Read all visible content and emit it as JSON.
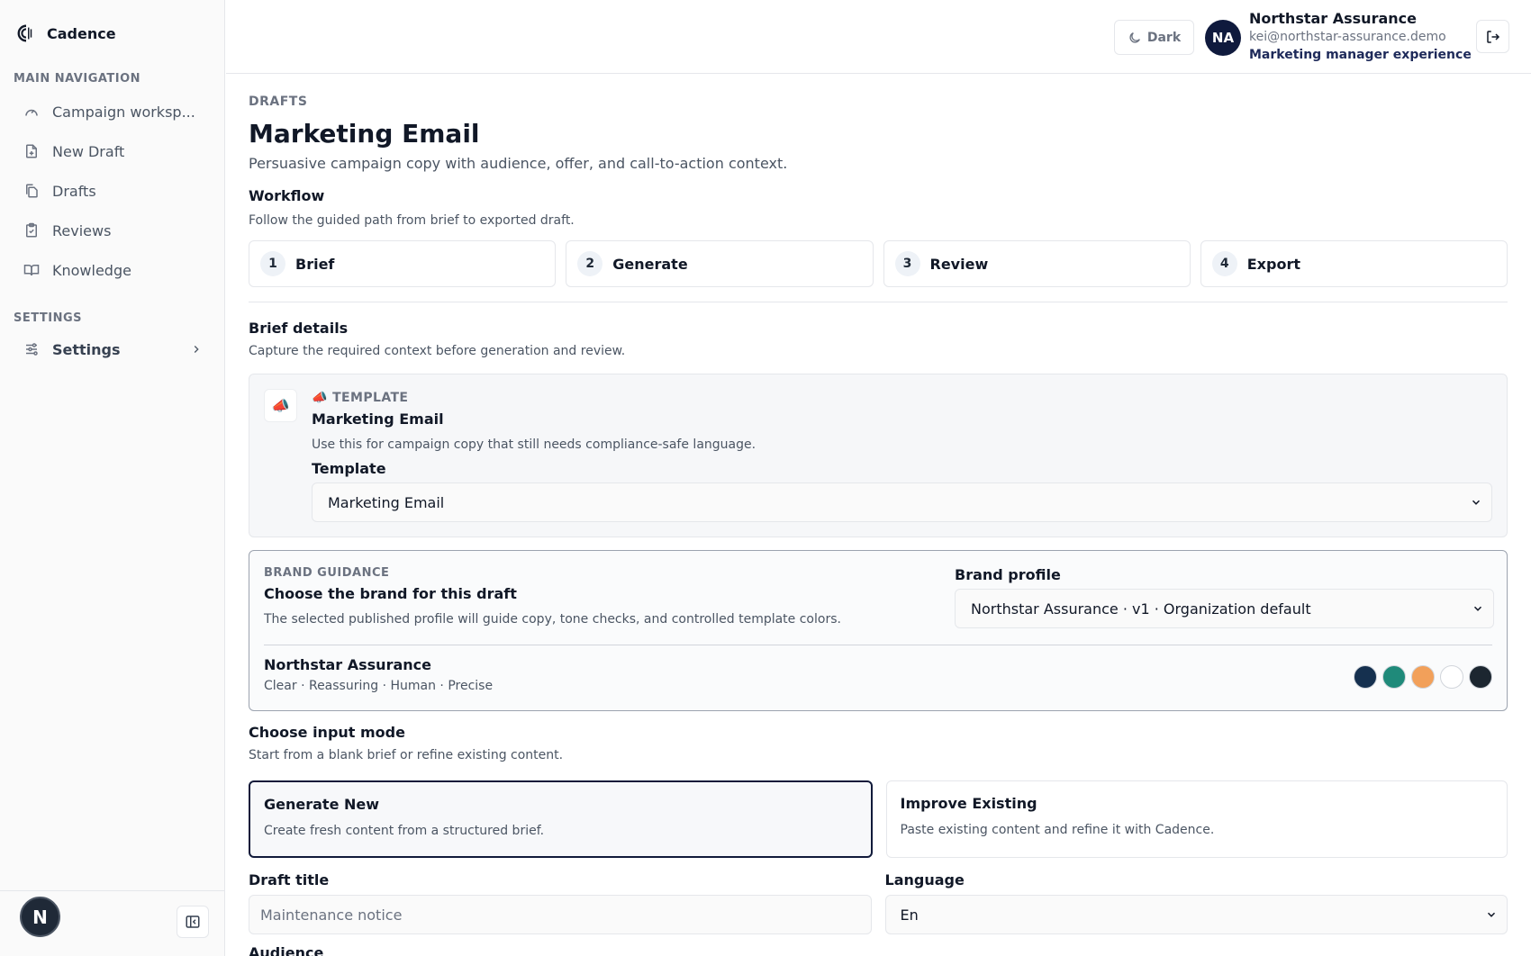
{
  "app": {
    "name": "Cadence"
  },
  "sidebar": {
    "main_label": "MAIN NAVIGATION",
    "items": [
      {
        "label": "Campaign worksp...",
        "icon": "gauge-icon"
      },
      {
        "label": "New Draft",
        "icon": "file-plus-icon"
      },
      {
        "label": "Drafts",
        "icon": "files-icon"
      },
      {
        "label": "Reviews",
        "icon": "clipboard-check-icon"
      },
      {
        "label": "Knowledge",
        "icon": "book-open-icon"
      }
    ],
    "settings_label": "SETTINGS",
    "settings_item": "Settings",
    "footer_avatar": "N"
  },
  "topbar": {
    "theme_label": "Dark",
    "user_initials": "NA",
    "user_name": "Northstar Assurance",
    "user_email": "kei@northstar-assurance.demo",
    "user_role": "Marketing manager experience"
  },
  "page": {
    "eyebrow": "DRAFTS",
    "title": "Marketing Email",
    "subtitle": "Persuasive campaign copy with audience, offer, and call-to-action context."
  },
  "workflow": {
    "title": "Workflow",
    "desc": "Follow the guided path from brief to exported draft.",
    "steps": [
      {
        "num": "1",
        "label": "Brief"
      },
      {
        "num": "2",
        "label": "Generate"
      },
      {
        "num": "3",
        "label": "Review"
      },
      {
        "num": "4",
        "label": "Export"
      }
    ]
  },
  "brief": {
    "title": "Brief details",
    "desc": "Capture the required context before generation and review."
  },
  "template": {
    "icon": "📣",
    "eyebrow": "📣 TEMPLATE",
    "title": "Marketing Email",
    "desc": "Use this for campaign copy that still needs compliance-safe language.",
    "field_label": "Template",
    "selected": "Marketing Email"
  },
  "brand": {
    "eyebrow": "BRAND GUIDANCE",
    "title": "Choose the brand for this draft",
    "desc": "The selected published profile will guide copy, tone checks, and controlled template colors.",
    "profile_label": "Brand profile",
    "profile_selected": "Northstar Assurance · v1 · Organization default",
    "name": "Northstar Assurance",
    "tones": "Clear · Reassuring · Human · Precise",
    "colors": [
      "#15304f",
      "#1f8a7a",
      "#f2a05a",
      "#ffffff",
      "#1c2630"
    ]
  },
  "input_mode": {
    "title": "Choose input mode",
    "desc": "Start from a blank brief or refine existing content.",
    "options": [
      {
        "title": "Generate New",
        "desc": "Create fresh content from a structured brief."
      },
      {
        "title": "Improve Existing",
        "desc": "Paste existing content and refine it with Cadence."
      }
    ]
  },
  "form": {
    "draft_title_label": "Draft title",
    "draft_title_placeholder": "Maintenance notice",
    "language_label": "Language",
    "language_selected": "En",
    "audience_label": "Audience"
  }
}
